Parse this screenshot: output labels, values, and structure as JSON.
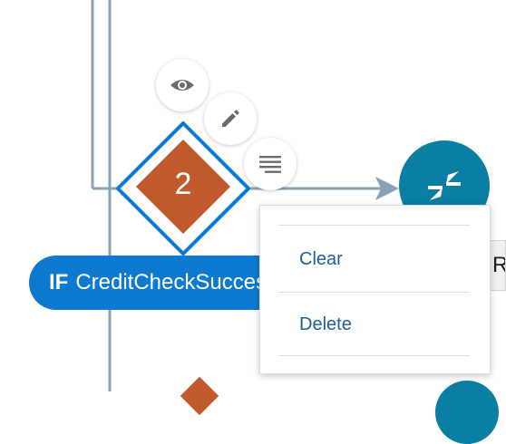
{
  "node": {
    "number": "2",
    "diamond_color": "#c0592c",
    "outline_color": "#0d79cf"
  },
  "node_actions": [
    {
      "name": "view",
      "icon": "eye-icon"
    },
    {
      "name": "edit",
      "icon": "pencil-icon"
    },
    {
      "name": "menu",
      "icon": "list-lines-icon"
    }
  ],
  "condition": {
    "keyword": "IF",
    "expression": "CreditCheckSuccess"
  },
  "behind_label": {
    "text": "Re"
  },
  "end_node": {
    "icon": "merge-arrows-icon",
    "color": "#0a7fa3"
  },
  "context_menu": {
    "items": [
      {
        "label": "Clear"
      },
      {
        "label": "Delete"
      }
    ]
  },
  "colors": {
    "connector": "#8da0b3",
    "pill": "#0d79cf",
    "menu_text": "#1d5d9a"
  }
}
